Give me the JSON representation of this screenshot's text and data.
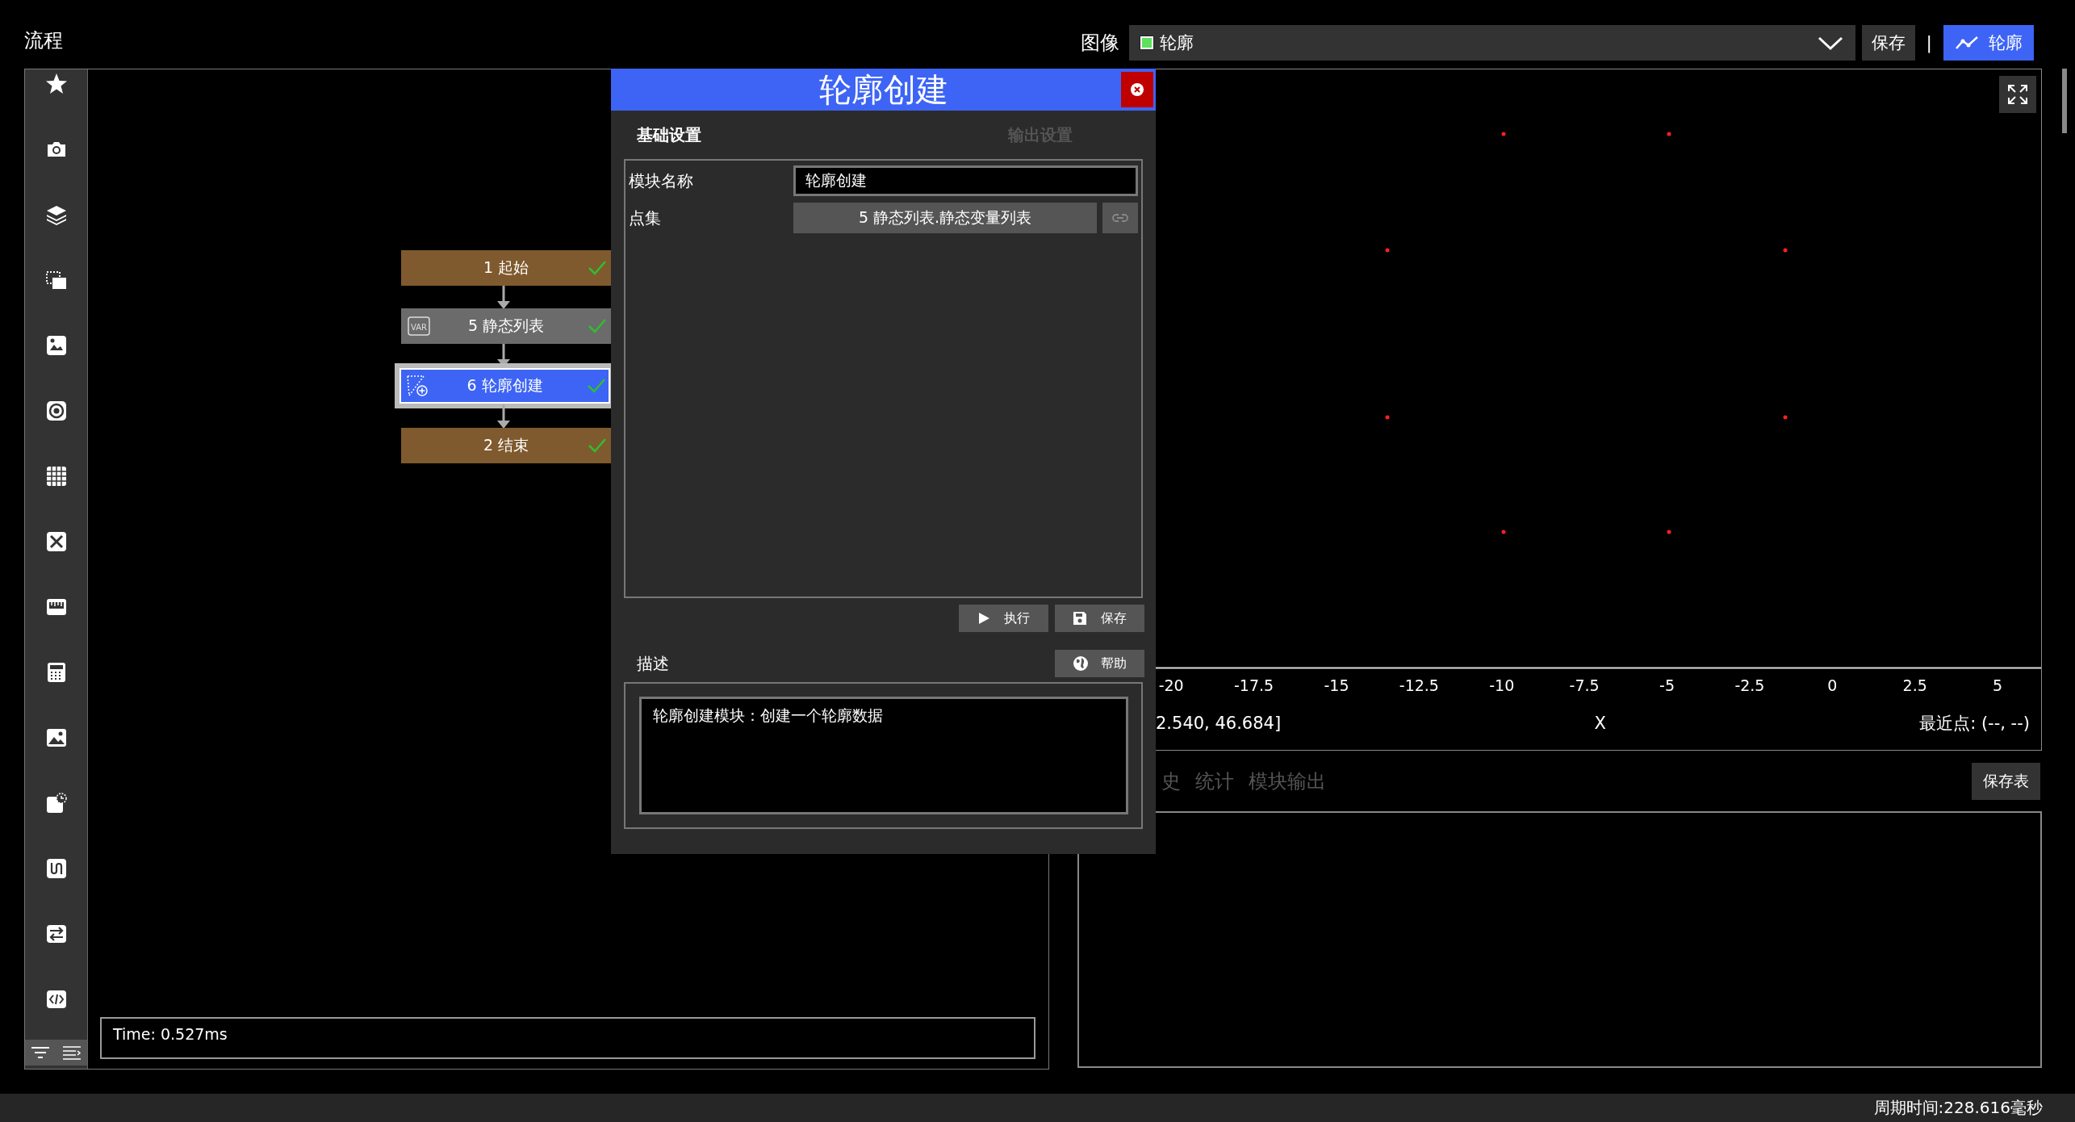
{
  "flow_panel": {
    "title": "流程",
    "nodes": [
      {
        "label": "1 起始",
        "kind": "terminal",
        "selected": false,
        "done": true
      },
      {
        "label": "5 静态列表",
        "kind": "variable",
        "icon_text": "VAR",
        "selected": false,
        "done": true
      },
      {
        "label": "6 轮廓创建",
        "kind": "contour",
        "selected": true,
        "done": true
      },
      {
        "label": "2 结束",
        "kind": "terminal",
        "selected": false,
        "done": true
      }
    ],
    "time": "Time: 0.527ms"
  },
  "image_toolbar": {
    "label": "图像",
    "dropdown_value": "轮廓",
    "save_button": "保存",
    "separator": "|",
    "contour_button": "轮廓"
  },
  "chart": {
    "x_ticks": [
      "-20",
      "-17.5",
      "-15",
      "-12.5",
      "-10",
      "-7.5",
      "-5",
      "-2.5",
      "0",
      "2.5",
      "5"
    ],
    "readout": "2.540, 46.684]",
    "axis_label": "X",
    "nearest_point": "最近点: (--, --)"
  },
  "result_tabs": [
    {
      "label": "史",
      "selected": false
    },
    {
      "label": "统计",
      "selected": false
    },
    {
      "label": "模块输出",
      "selected": false
    }
  ],
  "save_table_button": "保存表",
  "dialog": {
    "title": "轮廓创建",
    "tabs": [
      {
        "label": "基础设置",
        "selected": true
      },
      {
        "label": "输出设置",
        "selected": false
      }
    ],
    "fields": [
      {
        "label": "模块名称",
        "kind": "text",
        "value": "轮廓创建"
      },
      {
        "label": "点集",
        "kind": "link",
        "value": "5 静态列表.静态变量列表"
      }
    ],
    "buttons": [
      {
        "label": "执行",
        "kind": "run"
      },
      {
        "label": "保存",
        "kind": "save"
      }
    ],
    "description_label": "描述",
    "help_button": "帮助",
    "description": "轮廓创建模块：创建一个轮廓数据"
  },
  "status_bar": {
    "cycle_time": "周期时间:228.616毫秒"
  }
}
